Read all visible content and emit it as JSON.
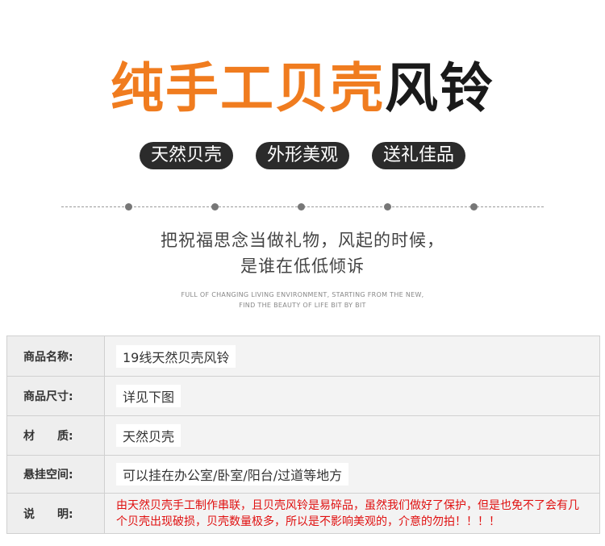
{
  "title": {
    "orange_part": "纯手工贝壳",
    "black_part": "风铃",
    "accent": "#f07c1f"
  },
  "tags": [
    "天然贝壳",
    "外形美观",
    "送礼佳品"
  ],
  "tagline": [
    "把祝福思念当做礼物，风起的时候，",
    "是谁在低低倾诉"
  ],
  "english": [
    "FULL OF CHANGING LIVING ENVIRONMENT, STARTING FROM THE NEW,",
    "FIND THE BEAUTY OF LIFE BIT BY BIT"
  ],
  "specs": [
    {
      "label": "商品名称:",
      "value": "19线天然贝壳风铃"
    },
    {
      "label": "商品尺寸:",
      "value": "详见下图"
    },
    {
      "label": "材　　质:",
      "value": "天然贝壳"
    },
    {
      "label": "悬挂空间:",
      "value": "可以挂在办公室/卧室/阳台/过道等地方"
    },
    {
      "label": "说　　明:",
      "value": "由天然贝壳手工制作串联，且贝壳风铃是易碎品，虽然我们做好了保护，但是也免不了会有几个贝壳出现破损，贝壳数量极多，所以是不影响美观的，介意的勿拍！！！！"
    }
  ],
  "note_color": "#e01010"
}
